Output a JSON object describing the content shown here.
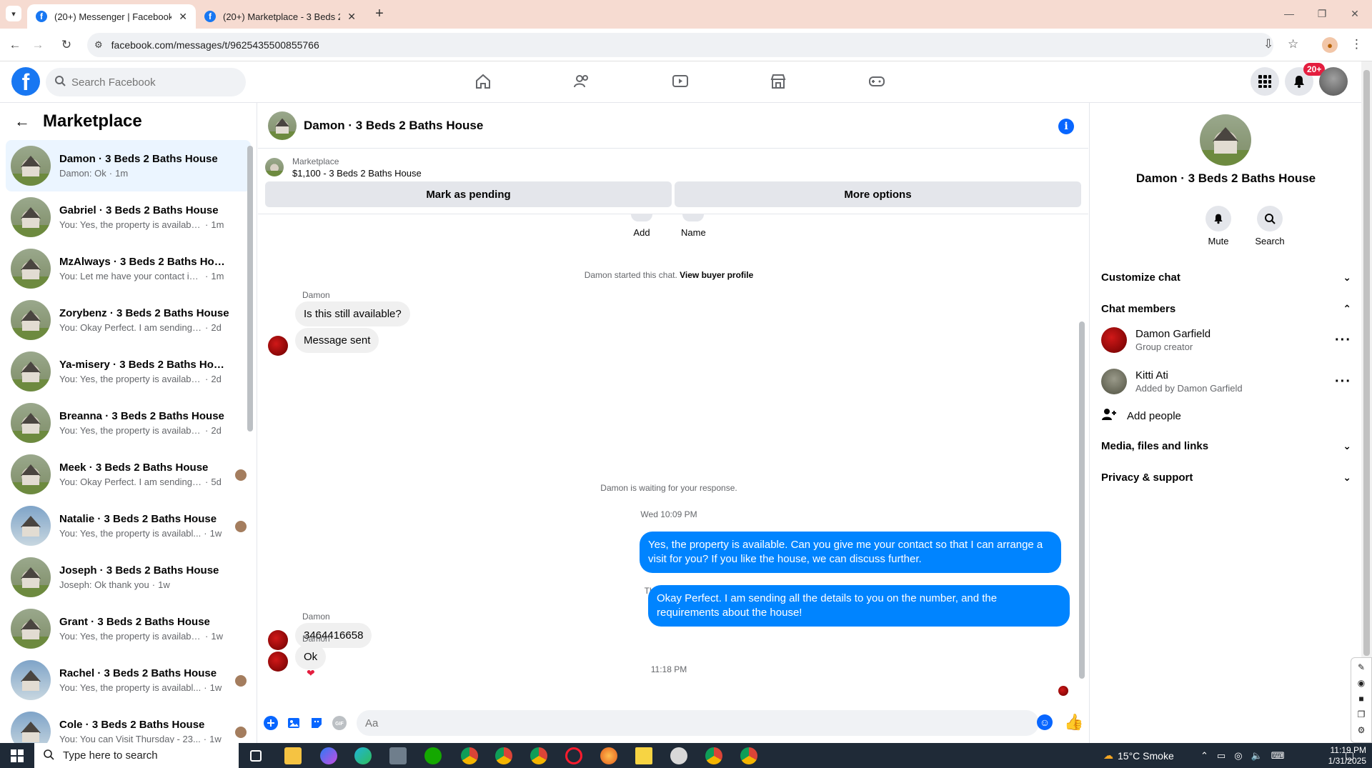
{
  "browser": {
    "tabs": [
      {
        "title": "(20+) Messenger | Facebook",
        "active": true
      },
      {
        "title": "(20+) Marketplace - 3 Beds 2 B",
        "active": false
      }
    ],
    "url": "facebook.com/messages/t/9625435500855766"
  },
  "fbnav": {
    "search_placeholder": "Search Facebook",
    "notif_badge": "20+",
    "icons": [
      "home-icon",
      "friends-icon",
      "video-icon",
      "marketplace-icon",
      "gaming-icon"
    ]
  },
  "sidebar": {
    "title": "Marketplace",
    "conversations": [
      {
        "name": "Damon · 3 Beds 2 Baths House",
        "preview": "Damon: Ok",
        "time": "1m",
        "active": true
      },
      {
        "name": "Gabriel · 3 Beds 2 Baths House",
        "preview": "You: Yes, the property is available. ...",
        "time": "1m"
      },
      {
        "name": "MzAlways · 3 Beds 2 Baths House",
        "preview": "You: Let me have your contact info...",
        "time": "1m"
      },
      {
        "name": "Zorybenz · 3 Beds 2 Baths House",
        "preview": "You: Okay Perfect. I am sending all ...",
        "time": "2d"
      },
      {
        "name": "Ya-misery · 3 Beds 2 Baths House",
        "preview": "You: Yes, the property is available. ...",
        "time": "2d"
      },
      {
        "name": "Breanna · 3 Beds 2 Baths House",
        "preview": "You: Yes, the property is available. ...",
        "time": "2d"
      },
      {
        "name": "Meek · 3 Beds 2 Baths House",
        "preview": "You: Okay Perfect. I am sending ...",
        "time": "5d",
        "seen": true
      },
      {
        "name": "Natalie · 3 Beds 2 Baths House",
        "preview": "You: Yes, the property is availabl...",
        "time": "1w",
        "seen": true,
        "alt": true
      },
      {
        "name": "Joseph · 3 Beds 2 Baths House",
        "preview": "Joseph: Ok thank you",
        "time": "1w"
      },
      {
        "name": "Grant · 3 Beds 2 Baths House",
        "preview": "You: Yes, the property is available. ...",
        "time": "1w"
      },
      {
        "name": "Rachel · 3 Beds 2 Baths House",
        "preview": "You: Yes, the property is availabl...",
        "time": "1w",
        "seen": true,
        "alt": true
      },
      {
        "name": "Cole · 3 Beds 2 Baths House",
        "preview": "You: You can Visit Thursday - 23...",
        "time": "1w",
        "seen": true,
        "alt": true
      }
    ]
  },
  "chat": {
    "title": "Damon · 3 Beds 2 Baths House",
    "listing": {
      "label": "Marketplace",
      "price_title": "$1,100 - 3 Beds 2 Baths House",
      "btn_pending": "Mark as pending",
      "btn_more": "More options"
    },
    "quick_actions": [
      "Add",
      "Name"
    ],
    "started_note": "Damon started this chat.",
    "view_profile": "View buyer profile",
    "sender_name": "Damon",
    "msg1": "Is this still available?",
    "msg2": "Message sent",
    "waiting_note": "Damon is waiting for your response.",
    "time1": "Wed 10:09 PM",
    "out1": "Yes, the property is available. Can you give me your contact so that I can arrange a visit for you? If you like the house, we can discuss further.",
    "time2": "Thu 7:20 PM",
    "msg3": "3464416658",
    "time3": "11:18 PM",
    "out2": "Okay Perfect. I am sending all the details to you on the number, and the requirements about the house!",
    "msg4": "Ok",
    "composer_placeholder": "Aa"
  },
  "rpanel": {
    "name": "Damon · 3 Beds 2 Baths House",
    "mute": "Mute",
    "search": "Search",
    "customize": "Customize chat",
    "members_title": "Chat members",
    "members": [
      {
        "name": "Damon Garfield",
        "sub": "Group creator"
      },
      {
        "name": "Kitti Ati",
        "sub": "Added by Damon Garfield"
      }
    ],
    "add_people": "Add people",
    "media": "Media, files and links",
    "privacy": "Privacy & support"
  },
  "taskbar": {
    "search_placeholder": "Type here to search",
    "weather": "15°C  Smoke",
    "time": "11:19 PM",
    "date": "1/31/2025"
  },
  "colors": {
    "accent": "#0866ff",
    "outgoing_bubble": "#0084ff",
    "tab_bg": "#f6dbd1"
  }
}
